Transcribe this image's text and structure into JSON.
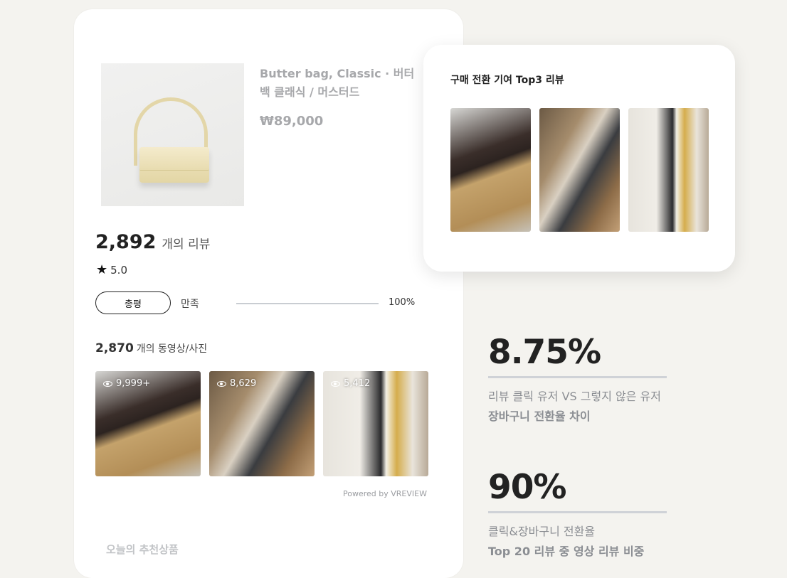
{
  "product": {
    "name": "Butter bag, Classic · 버터백 클래식 / 머스터드",
    "price": "₩89,000",
    "image_icon": "bag-photo"
  },
  "reviews": {
    "count": "2,892",
    "count_label": "개의 리뷰",
    "rating": "5.0",
    "filter_pill": "총평",
    "satisfaction_label": "만족",
    "satisfaction_pct": "100%",
    "satisfaction_fraction": 1.0
  },
  "media": {
    "count": "2,870",
    "count_label": "개의 동영상/사진",
    "thumbs": [
      {
        "views": "9,999+"
      },
      {
        "views": "8,629"
      },
      {
        "views": "5,412"
      }
    ],
    "powered_by": "Powered by VREVIEW"
  },
  "recommend": {
    "title": "오늘의 추천상품"
  },
  "top3": {
    "title": "구매 전환 기여 Top3 리뷰"
  },
  "stats": [
    {
      "value": "8.75%",
      "line1": "리뷰 클릭 유저 VS 그렇지 않은 유저",
      "line2": "장바구니 전환율 차이"
    },
    {
      "value": "90%",
      "line1": "클릭&장바구니 전환율",
      "line2": "Top 20 리뷰 중 영상 리뷰 비중"
    }
  ],
  "colors": {
    "background": "#f4f3ef",
    "muted_text": "#a7a8ab",
    "stat_text": "#8b8e93"
  }
}
